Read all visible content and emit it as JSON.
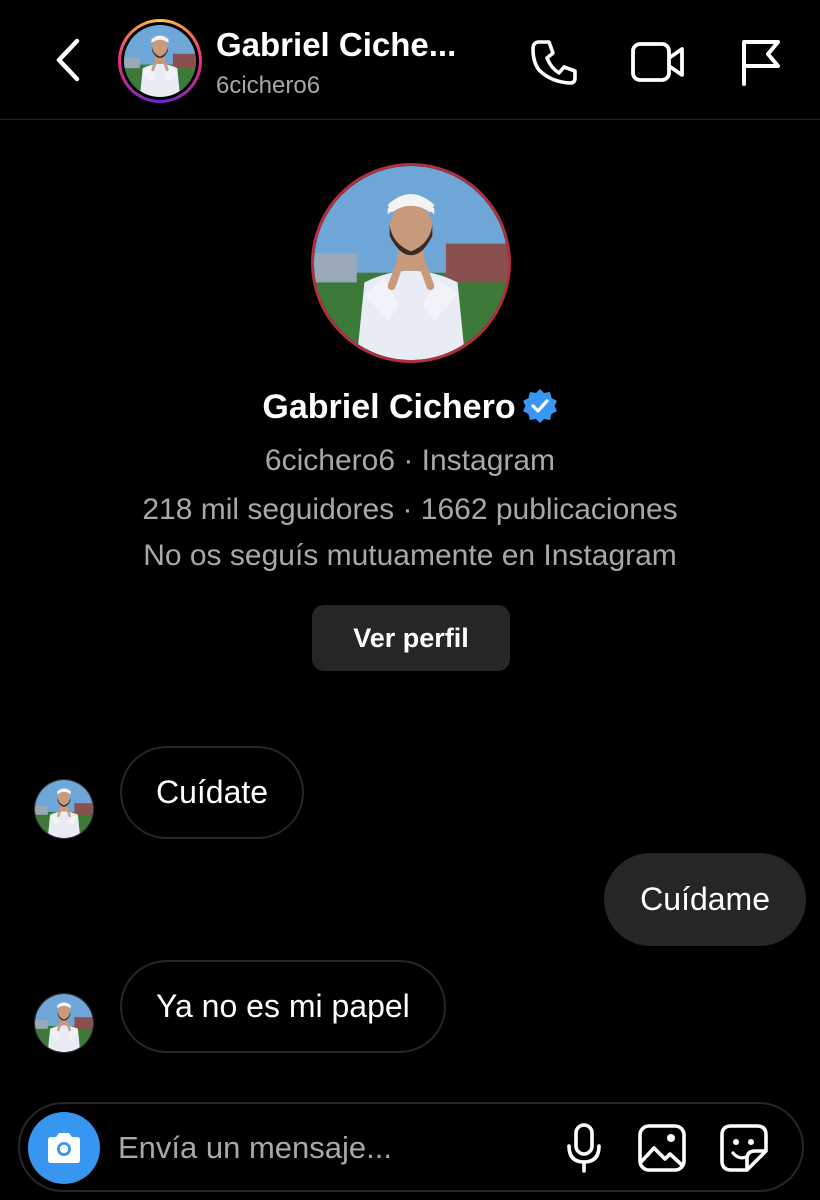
{
  "header": {
    "title": "Gabriel Ciche...",
    "username": "6cichero6",
    "back_icon": "chevron-left-icon",
    "call_icon": "phone-icon",
    "video_icon": "video-camera-icon",
    "report_icon": "flag-icon"
  },
  "profile": {
    "name": "Gabriel Cichero",
    "verified_icon": "verified-badge-icon",
    "verified_color": "#3897f0",
    "subline": "6cichero6 · Instagram",
    "stats": "218 mil seguidores · 1662 publicaciones",
    "relation": "No os seguís mutuamente en Instagram",
    "view_profile_label": "Ver perfil"
  },
  "messages": [
    {
      "direction": "incoming",
      "text": "Cuídate"
    },
    {
      "direction": "outgoing",
      "text": "Cuídame"
    },
    {
      "direction": "incoming",
      "text": "Ya no es mi papel"
    }
  ],
  "composer": {
    "placeholder": "Envía un mensaje...",
    "camera_icon": "camera-icon",
    "mic_icon": "microphone-icon",
    "gallery_icon": "image-icon",
    "sticker_icon": "sticker-icon",
    "camera_color": "#3797f0"
  }
}
